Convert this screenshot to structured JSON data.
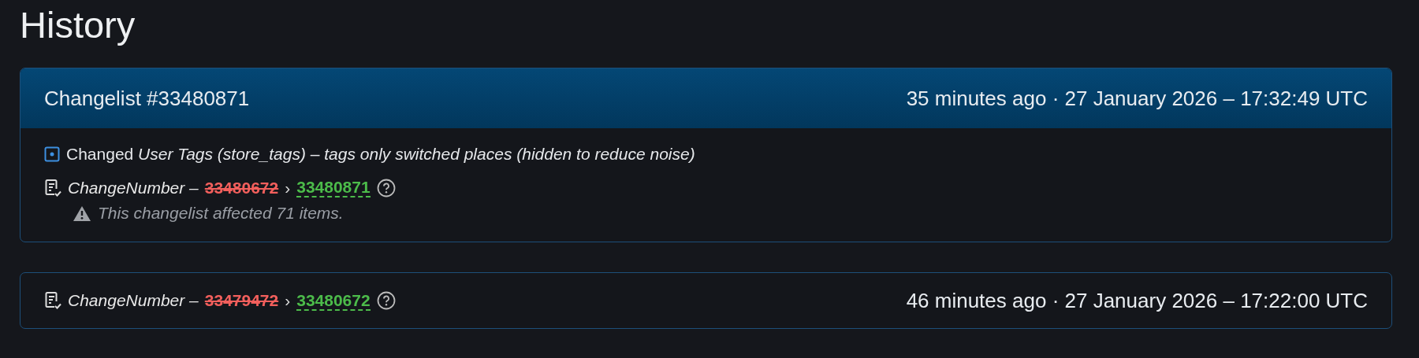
{
  "title": "History",
  "changelists": [
    {
      "kind": "expanded",
      "header": "Changelist #33480871",
      "time": "35 minutes ago · 27 January 2026 – 17:32:49 UTC",
      "changes": [
        {
          "kind": "tags",
          "text": "Changed *User Tags (store_tags)* – *tags only switched places (hidden to reduce noise)*"
        },
        {
          "kind": "number",
          "field": "ChangeNumber –",
          "old": "33480672",
          "separator": "›",
          "new": "33480871",
          "warning": "This changelist affected 71 items."
        }
      ]
    },
    {
      "kind": "compact",
      "time": "46 minutes ago · 27 January 2026 – 17:22:00 UTC",
      "changes": [
        {
          "kind": "number",
          "field": "ChangeNumber –",
          "old": "33479472",
          "separator": "›",
          "new": "33480672"
        }
      ]
    }
  ]
}
